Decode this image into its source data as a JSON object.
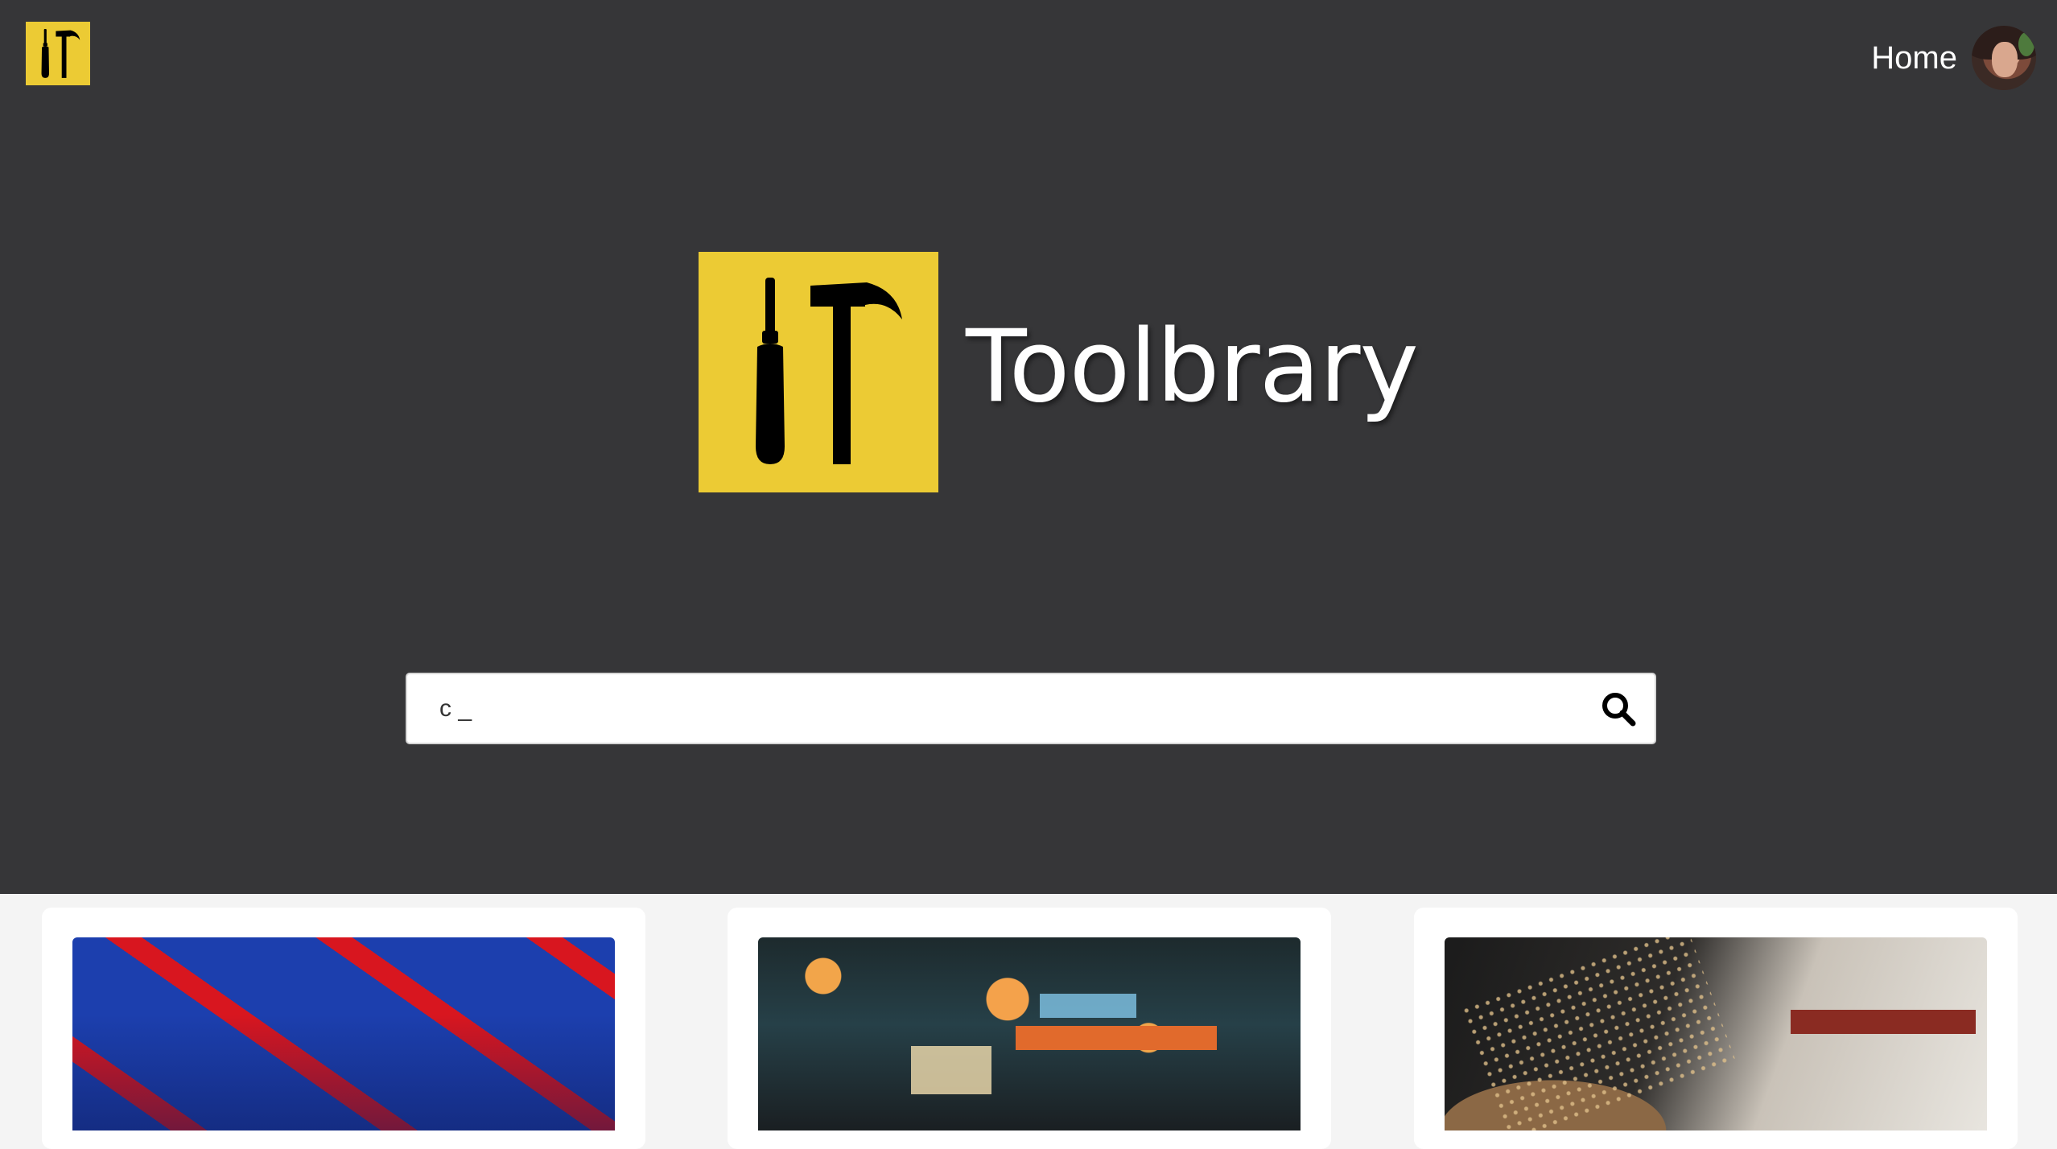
{
  "header": {
    "home_label": "Home"
  },
  "brand": {
    "name": "Toolbrary"
  },
  "search": {
    "value": "c _",
    "placeholder": ""
  },
  "colors": {
    "hero_background": "#363638",
    "logo_yellow": "#eccb34",
    "page_background": "#f4f4f4"
  },
  "icons": {
    "corner_logo": "screwdriver-hammer-icon",
    "brand_logo": "screwdriver-hammer-icon",
    "search": "search-icon"
  },
  "cards": [
    {
      "image": "red-blue-bridge-photo"
    },
    {
      "image": "night-street-signs-photo"
    },
    {
      "image": "woodworking-lathe-photo"
    }
  ]
}
